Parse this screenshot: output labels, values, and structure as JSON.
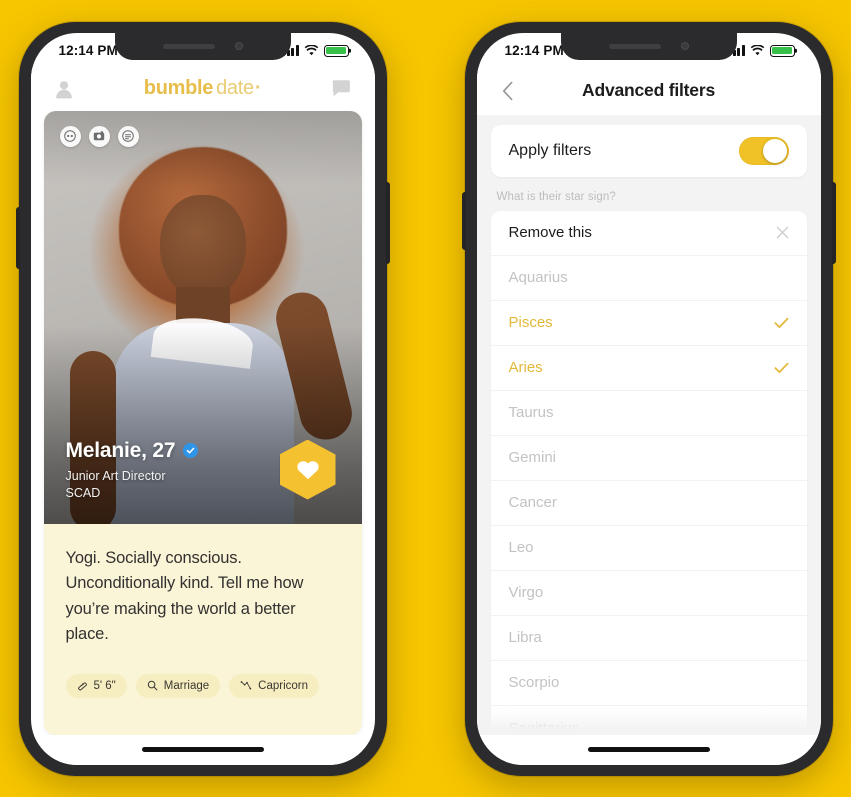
{
  "theme": {
    "background": "#F7C600",
    "brand_yellow": "#F0C227",
    "accent_yellow": "#E3B93C",
    "card_cream": "#FBF5D7",
    "tag_cream": "#F6EDC0",
    "verified_blue": "#2F95E8",
    "battery_green": "#37C14A"
  },
  "left_phone": {
    "status_bar": {
      "time": "12:14 PM",
      "signal_icon": "cellular-bars-icon",
      "wifi_icon": "wifi-icon",
      "battery_icon": "battery-full-icon"
    },
    "app_header": {
      "profile_icon": "person-icon",
      "brand_bold": "bumble",
      "brand_light": "date",
      "brand_dot": "·",
      "chat_icon": "chat-bubble-icon"
    },
    "card": {
      "media_chips": [
        {
          "icon": "voice-note-icon",
          "name": "voice-prompt-chip"
        },
        {
          "icon": "camera-icon",
          "name": "photo-chip"
        },
        {
          "icon": "text-prompt-icon",
          "name": "text-prompt-chip"
        }
      ],
      "profile": {
        "name_age": "Melanie, 27",
        "verified_icon": "verified-check-icon",
        "job_title": "Junior Art Director",
        "school": "SCAD"
      },
      "like_button": {
        "icon": "heart-icon",
        "shape": "hexagon",
        "label": "Like"
      },
      "bio": "Yogi. Socially conscious. Unconditionally kind. Tell me how you’re making the world a better place.",
      "tags": [
        {
          "icon": "ruler-icon",
          "label": "5' 6\""
        },
        {
          "icon": "search-icon",
          "label": "Marriage"
        },
        {
          "icon": "constellation-icon",
          "label": "Capricorn"
        }
      ]
    }
  },
  "right_phone": {
    "status_bar": {
      "time": "12:14 PM",
      "signal_icon": "cellular-bars-icon",
      "wifi_icon": "wifi-icon",
      "battery_icon": "battery-full-icon"
    },
    "nav": {
      "back_icon": "chevron-left-icon",
      "title": "Advanced filters"
    },
    "apply_filters": {
      "label": "Apply filters",
      "toggle_state": "on"
    },
    "section_question": "What is their star sign?",
    "rows": [
      {
        "label": "Remove this",
        "state": "action",
        "trailing_icon": "close-x-icon"
      },
      {
        "label": "Aquarius",
        "state": "default",
        "trailing_icon": ""
      },
      {
        "label": "Pisces",
        "state": "selected",
        "trailing_icon": "checkmark-icon"
      },
      {
        "label": "Aries",
        "state": "selected",
        "trailing_icon": "checkmark-icon"
      },
      {
        "label": "Taurus",
        "state": "default",
        "trailing_icon": ""
      },
      {
        "label": "Gemini",
        "state": "default",
        "trailing_icon": ""
      },
      {
        "label": "Cancer",
        "state": "default",
        "trailing_icon": ""
      },
      {
        "label": "Leo",
        "state": "default",
        "trailing_icon": ""
      },
      {
        "label": "Virgo",
        "state": "default",
        "trailing_icon": ""
      },
      {
        "label": "Libra",
        "state": "default",
        "trailing_icon": ""
      },
      {
        "label": "Scorpio",
        "state": "default",
        "trailing_icon": ""
      },
      {
        "label": "Sagittarius",
        "state": "default",
        "trailing_icon": ""
      }
    ]
  }
}
